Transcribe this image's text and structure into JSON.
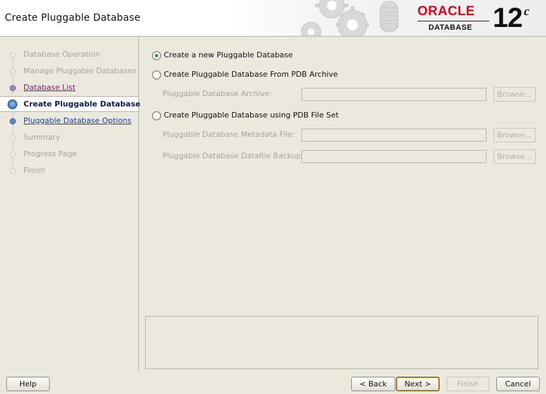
{
  "header": {
    "title": "Create Pluggable Database",
    "logo_brand": "ORACLE",
    "logo_registered": "®",
    "logo_product": "DATABASE",
    "version_number": "12",
    "version_suffix": "c"
  },
  "sidebar": {
    "steps": [
      {
        "label": "Database Operation",
        "state": "pending"
      },
      {
        "label": "Manage Pluggable Databases",
        "state": "pending"
      },
      {
        "label": "Database List",
        "state": "visited"
      },
      {
        "label": "Create Pluggable Database",
        "state": "current"
      },
      {
        "label": "Pluggable Database Options",
        "state": "link"
      },
      {
        "label": "Summary",
        "state": "pending"
      },
      {
        "label": "Progress Page",
        "state": "pending"
      },
      {
        "label": "Finish",
        "state": "pending"
      }
    ]
  },
  "options": {
    "new_pdb": {
      "label": "Create a new Pluggable Database",
      "selected": true
    },
    "from_archive": {
      "label": "Create Pluggable Database From PDB Archive",
      "selected": false,
      "archive_label": "Pluggable Database Archive:",
      "archive_value": "",
      "browse_label": "Browse..."
    },
    "from_fileset": {
      "label": "Create Pluggable Database using PDB File Set",
      "selected": false,
      "metadata_label": "Pluggable Database Metadata File:",
      "metadata_value": "",
      "datafile_label": "Pluggable Database Datafile Backup:",
      "datafile_value": "",
      "browse_label": "Browse..."
    }
  },
  "footer": {
    "help": "Help",
    "back": "< Back",
    "next": "Next >",
    "finish": "Finish",
    "cancel": "Cancel"
  },
  "colors": {
    "background": "#ebe8de",
    "oracle_red": "#e3001b",
    "current_step": "#0d1b4d",
    "link": "#1a3ea3",
    "visited_link": "#7b1b6e"
  }
}
